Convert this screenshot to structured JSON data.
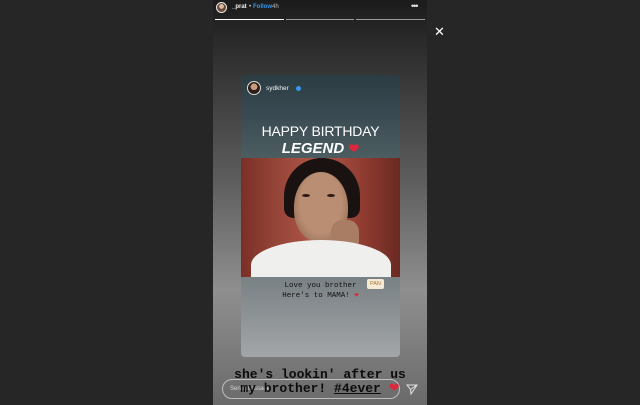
{
  "header": {
    "username": "_prat",
    "separator": "•",
    "follow_label": "Follow",
    "time": "4h",
    "more_icon": "more-horizontal-icon"
  },
  "progress": {
    "segments": 3,
    "active_index": 0
  },
  "close_icon": "close-icon",
  "shared_post": {
    "username": "sydkher",
    "verified": true,
    "headline_line1": "HAPPY BIRTHDAY",
    "headline_line2": "LEGEND",
    "caption_line1": "Love you brother",
    "caption_line2": "Here's to MAMA!",
    "sticker": "PAN"
  },
  "story_text": {
    "line1": "she's lookin' after us",
    "line2_prefix": "my brother!",
    "hashtag": "#4ever"
  },
  "reply": {
    "placeholder": "Send message",
    "send_icon": "send-icon"
  },
  "colors": {
    "follow": "#3897f0",
    "heart": "#e0263c",
    "verified": "#3897f0"
  }
}
